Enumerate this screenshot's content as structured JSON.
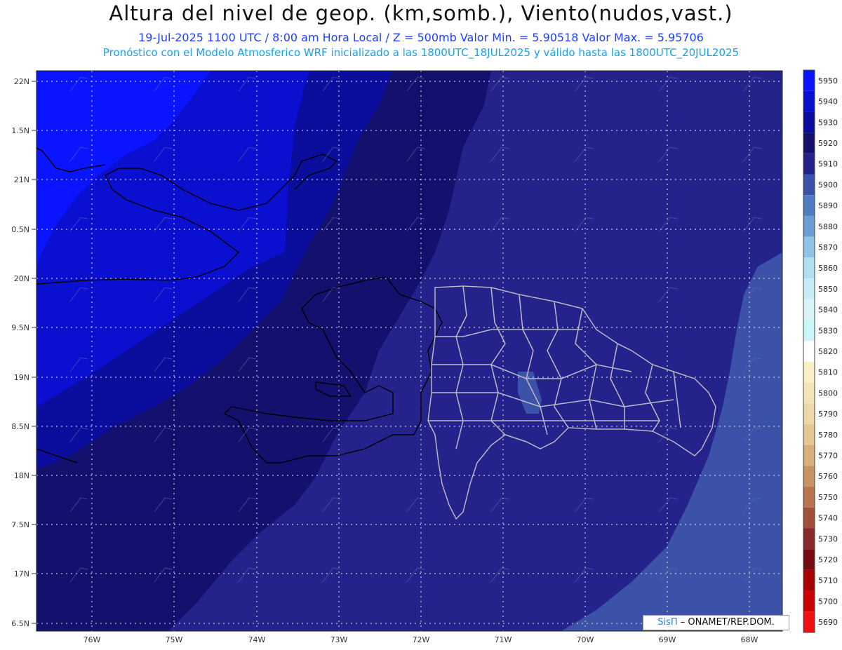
{
  "header": {
    "title": "Altura del nivel de geop. (km,somb.), Viento(nudos,vast.)",
    "subtitle": "19-Jul-2025   1100 UTC / 8:00 am Hora Local / Z = 500mb     Valor Min. = 5.90518  Valor Max. = 5.95706",
    "model_line": "Pronóstico con el Modelo Atmosferico WRF inicializado a las 1800UTC_18JUL2025 y válido hasta las  1800UTC_20JUL2025"
  },
  "map": {
    "lat_labels": [
      "22N",
      "1.5N",
      "21N",
      "0.5N",
      "20N",
      "9.5N",
      "19N",
      "8.5N",
      "18N",
      "7.5N",
      "17N",
      "6.5N"
    ],
    "lon_labels": [
      "76W",
      "75W",
      "74W",
      "73W",
      "72W",
      "71W",
      "70W",
      "69W",
      "68W"
    ]
  },
  "colorbar": {
    "levels": [
      5950,
      5940,
      5930,
      5920,
      5910,
      5900,
      5890,
      5880,
      5870,
      5860,
      5850,
      5840,
      5830,
      5820,
      5810,
      5800,
      5790,
      5780,
      5770,
      5760,
      5750,
      5740,
      5730,
      5720,
      5710,
      5700,
      5690
    ],
    "colors": [
      "#0a14ff",
      "#0a0fd0",
      "#0b0d9c",
      "#14106e",
      "#24238c",
      "#3b52a8",
      "#4f7cc2",
      "#6a9ed2",
      "#8cc3e6",
      "#b0dff0",
      "#c6ecf5",
      "#d8f4f8",
      "#caf6f7",
      "#ffffff",
      "#faf0c8",
      "#f3e4b8",
      "#ecd8a8",
      "#e4c894",
      "#d8ae7a",
      "#c99262",
      "#b8744e",
      "#a0503a",
      "#8a2a2c",
      "#780a14",
      "#a80000",
      "#cc0000",
      "#f01010"
    ]
  },
  "credit": {
    "brand": "SisΠ",
    "text": "– ONAMET/REP.DOM."
  }
}
